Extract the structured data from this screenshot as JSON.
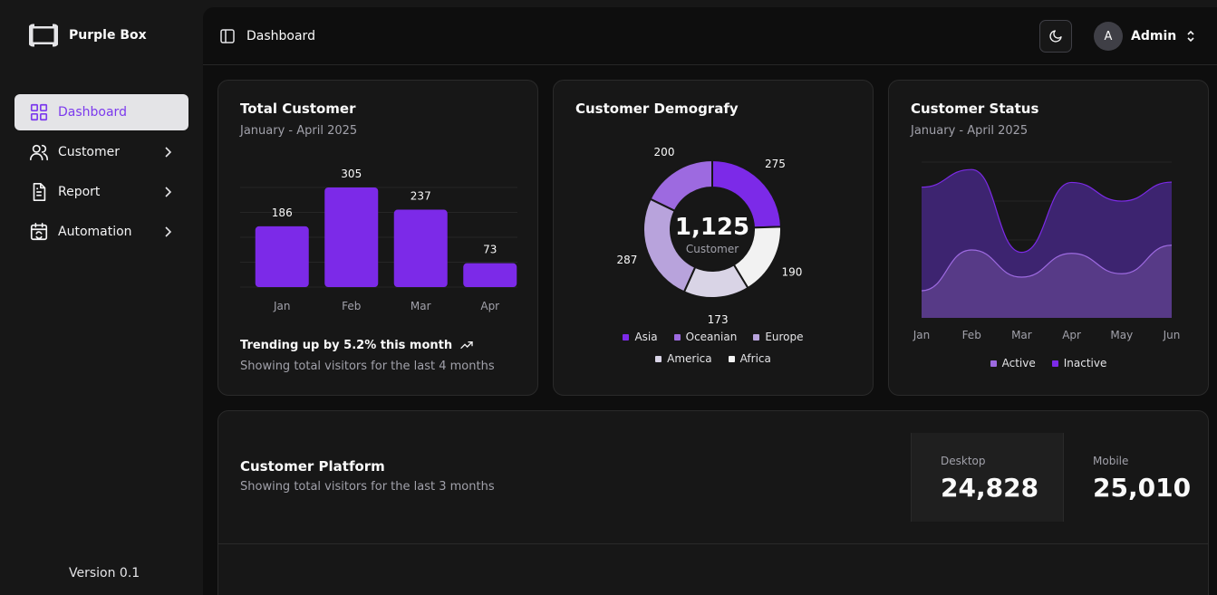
{
  "brand": {
    "name": "Purple Box"
  },
  "sidebar": {
    "items": [
      {
        "label": "Dashboard",
        "icon": "grid-icon"
      },
      {
        "label": "Customer",
        "icon": "users-icon"
      },
      {
        "label": "Report",
        "icon": "document-icon"
      },
      {
        "label": "Automation",
        "icon": "calendar-sync-icon"
      }
    ],
    "version": "Version 0.1"
  },
  "header": {
    "title": "Dashboard",
    "theme_icon": "moon-icon",
    "user": {
      "initial": "A",
      "name": "Admin"
    }
  },
  "colors": {
    "accent": "#7c2ae8",
    "background": "#0e0e0e",
    "card": "#171717"
  },
  "total_customer": {
    "title": "Total Customer",
    "subtitle": "January - April 2025",
    "trend": "Trending up by 5.2% this month",
    "footnote": "Showing total visitors for the last 4 months"
  },
  "demography": {
    "title": "Customer Demografy",
    "center_value": "1,125",
    "center_label": "Customer"
  },
  "status": {
    "title": "Customer Status",
    "subtitle": "January - April 2025"
  },
  "platform": {
    "title": "Customer Platform",
    "subtitle": "Showing total visitors for the last 3 months",
    "desktop_label": "Desktop",
    "desktop_value": "24,828",
    "mobile_label": "Mobile",
    "mobile_value": "25,010"
  },
  "chart_data": [
    {
      "type": "bar",
      "categories": [
        "Jan",
        "Feb",
        "Mar",
        "Apr"
      ],
      "values": [
        186,
        305,
        237,
        73
      ],
      "color": "#7c2ae8"
    },
    {
      "type": "pie",
      "categories": [
        "Asia",
        "Oceanian",
        "Europe",
        "America",
        "Africa"
      ],
      "values": [
        275,
        200,
        287,
        173,
        190
      ],
      "colors": [
        "#7c2ae8",
        "#9d6ae0",
        "#b8a3dc",
        "#d9d4e6",
        "#f2f2f2"
      ]
    },
    {
      "type": "area",
      "categories": [
        "Jan",
        "Feb",
        "Mar",
        "Apr",
        "May",
        "Jun"
      ],
      "series": [
        {
          "name": "Active",
          "values": [
            80,
            200,
            120,
            190,
            130,
            214
          ]
        },
        {
          "name": "Inactive",
          "values": [
            305,
            237,
            73,
            209,
            214,
            186
          ]
        }
      ],
      "colors": {
        "Active": "#9d6ae0",
        "Inactive": "#7c2ae8"
      }
    }
  ]
}
